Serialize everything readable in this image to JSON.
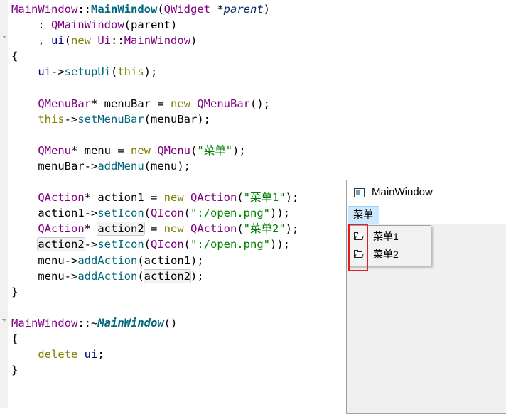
{
  "editor": {
    "lines": [
      [
        "MainWindow",
        "::",
        "MainWindow",
        "(",
        "QWidget",
        " *",
        "parent",
        ")"
      ],
      [
        "    : ",
        "QMainWindow",
        "(",
        "parent",
        ")"
      ],
      [
        "    , ",
        "ui",
        "(",
        "new",
        " ",
        "Ui",
        "::",
        "MainWindow",
        ")"
      ],
      [
        "{"
      ],
      [
        "    ",
        "ui",
        "->",
        "setupUi",
        "(",
        "this",
        ");"
      ],
      [
        ""
      ],
      [
        "    ",
        "QMenuBar",
        "* ",
        "menuBar",
        " = ",
        "new",
        " ",
        "QMenuBar",
        "();"
      ],
      [
        "    ",
        "this",
        "->",
        "setMenuBar",
        "(",
        "menuBar",
        ");"
      ],
      [
        ""
      ],
      [
        "    ",
        "QMenu",
        "* ",
        "menu",
        " = ",
        "new",
        " ",
        "QMenu",
        "(",
        "\"菜单\"",
        ");"
      ],
      [
        "    ",
        "menuBar",
        "->",
        "addMenu",
        "(",
        "menu",
        ");"
      ],
      [
        ""
      ],
      [
        "    ",
        "QAction",
        "* ",
        "action1",
        " = ",
        "new",
        " ",
        "QAction",
        "(",
        "\"菜单1\"",
        ");"
      ],
      [
        "    ",
        "action1",
        "->",
        "setIcon",
        "(",
        "QIcon",
        "(",
        "\":/open.png\"",
        "));"
      ],
      [
        "    ",
        "QAction",
        "* ",
        "action2",
        " = ",
        "new",
        " ",
        "QAction",
        "(",
        "\"菜单2\"",
        ");"
      ],
      [
        "    ",
        "action2",
        "->",
        "setIcon",
        "(",
        "QIcon",
        "(",
        "\":/open.png\"",
        "));"
      ],
      [
        "    ",
        "menu",
        "->",
        "addAction",
        "(",
        "action1",
        ");"
      ],
      [
        "    ",
        "menu",
        "->",
        "addAction",
        "(",
        "action2",
        ");"
      ],
      [
        "}"
      ],
      [
        ""
      ],
      [
        "MainWindow",
        "::~",
        "MainWindow",
        "()"
      ],
      [
        "{"
      ],
      [
        "    ",
        "delete",
        " ",
        "ui",
        ";"
      ],
      [
        "}"
      ]
    ],
    "classes": [
      [
        "t-cls",
        "",
        "t-fnb",
        "",
        "t-cls",
        "",
        "t-param",
        ""
      ],
      [
        "",
        "t-cls",
        "",
        "",
        ""
      ],
      [
        "",
        "t-type",
        "",
        "t-kw",
        "",
        "t-cls",
        "",
        "t-cls",
        ""
      ],
      [
        ""
      ],
      [
        "",
        "t-type",
        "",
        "t-fn",
        "",
        "t-kw",
        ""
      ],
      [
        ""
      ],
      [
        "",
        "t-cls",
        "",
        "",
        "",
        "t-kw",
        "",
        "t-cls",
        ""
      ],
      [
        "",
        "t-kw",
        "",
        "t-fn",
        "",
        "",
        ""
      ],
      [
        ""
      ],
      [
        "",
        "t-cls",
        "",
        "",
        "",
        "t-kw",
        "",
        "t-cls",
        "",
        "t-str",
        ""
      ],
      [
        "",
        "",
        "",
        "t-fn",
        "",
        "",
        ""
      ],
      [
        ""
      ],
      [
        "",
        "t-cls",
        "",
        "",
        "",
        "t-kw",
        "",
        "t-cls",
        "",
        "t-str",
        ""
      ],
      [
        "",
        "",
        "",
        "t-fn",
        "",
        "t-cls",
        "",
        "t-str",
        ""
      ],
      [
        "",
        "t-cls",
        "",
        "t-hl",
        "",
        "t-kw",
        "",
        "t-cls",
        "",
        "t-str",
        ""
      ],
      [
        "",
        "t-hl",
        "",
        "t-fn",
        "",
        "t-cls",
        "",
        "t-str",
        ""
      ],
      [
        "",
        "",
        "",
        "t-fn",
        "",
        "",
        ""
      ],
      [
        "",
        "",
        "",
        "t-fn",
        "",
        "t-hl",
        ""
      ],
      [
        ""
      ],
      [
        ""
      ],
      [
        "t-cls",
        "",
        "t-fnbi",
        ""
      ],
      [
        ""
      ],
      [
        "",
        "t-kw",
        "",
        "t-type",
        ""
      ],
      [
        ""
      ]
    ]
  },
  "app_window": {
    "title": "MainWindow",
    "menubar": {
      "menu_label": "菜单"
    },
    "popup": {
      "items": [
        {
          "label": "菜单1",
          "icon": "folder-open-icon"
        },
        {
          "label": "菜单2",
          "icon": "folder-open-icon"
        }
      ]
    },
    "annotation_color": "#e02020"
  }
}
